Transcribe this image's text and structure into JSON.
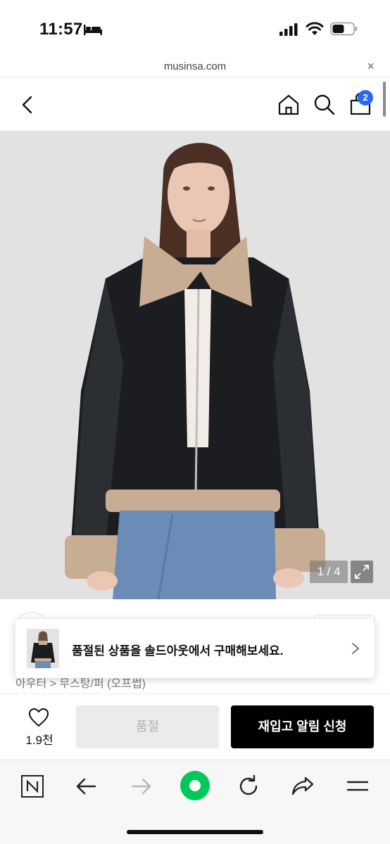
{
  "status_bar": {
    "time": "11:57",
    "icons": [
      "sleep-icon",
      "signal-icon",
      "wifi-icon",
      "battery-icon"
    ]
  },
  "url_bar": {
    "url": "musinsa.com",
    "close_label": "×"
  },
  "header": {
    "icons": [
      "back-icon",
      "home-icon",
      "search-icon",
      "shopping-bag-icon"
    ],
    "cart_count": "2"
  },
  "gallery": {
    "counter": "1 / 4",
    "current": 1,
    "total": 4
  },
  "breadcrumb": "아우터 > 무스탕/퍼 (오프썹)",
  "soldout_banner": {
    "text": "품절된 상품을 솔드아웃에서 구매해보세요."
  },
  "purchase": {
    "like_count": "1.9천",
    "soldout_label": "품절",
    "restock_label": "재입고 알림 신청"
  },
  "browser_toolbar": {
    "icons": [
      "naver-n-icon",
      "back-arrow-icon",
      "forward-arrow-icon",
      "green-dot-icon",
      "refresh-icon",
      "share-icon",
      "menu-icon"
    ]
  },
  "colors": {
    "badge": "#2b67f6",
    "restock_button": "#000000",
    "soldout_button": "#ebebeb",
    "green_button": "#03c75a"
  }
}
